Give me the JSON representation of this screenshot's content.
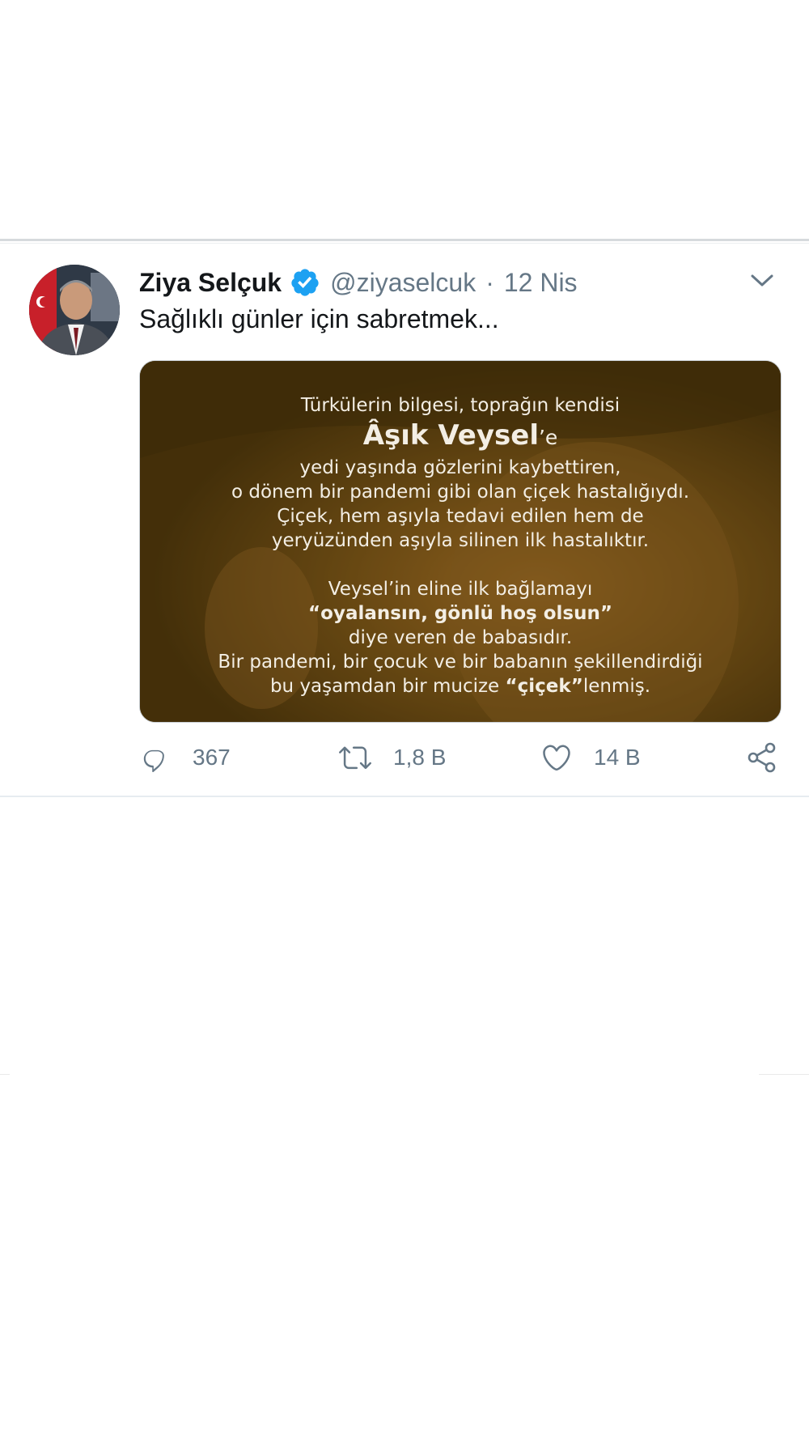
{
  "tweet": {
    "author_name": "Ziya Selçuk",
    "handle": "@ziyaselcuk",
    "separator": "·",
    "time": "12 Nis",
    "text": "Sağlıklı günler için sabretmek...",
    "media": {
      "line1": "Türkülerin bilgesi, toprağın kendisi",
      "line2_main": "Âşık Veysel",
      "line2_suffix": "’e",
      "line3": "yedi yaşında gözlerini kaybettiren,",
      "line4": "o dönem bir pandemi gibi olan çiçek hastalığıydı.",
      "line5": "Çiçek, hem aşıyla tedavi edilen hem de",
      "line6": "yeryüzünden aşıyla silinen ilk hastalıktır.",
      "line7": "Veysel’in eline ilk bağlamayı",
      "line8": "“oyalansın, gönlü hoş olsun”",
      "line9": "diye veren de babasıdır.",
      "line10": "Bir pandemi, bir çocuk ve bir babanın şekillendirdiği",
      "line11_pre": "bu yaşamdan bir mucize ",
      "line11_bold": "“çiçek”",
      "line11_post": "lenmiş."
    },
    "actions": {
      "replies": "367",
      "retweets": "1,8 B",
      "likes": "14 B"
    }
  },
  "colors": {
    "verified": "#1da1f2",
    "secondary_text": "#657786",
    "media_overlay": "#5a4012"
  },
  "icons": {
    "verified": "verified-badge-icon",
    "caret": "chevron-down-icon",
    "reply": "reply-icon",
    "retweet": "retweet-icon",
    "like": "heart-icon",
    "share": "share-icon"
  }
}
